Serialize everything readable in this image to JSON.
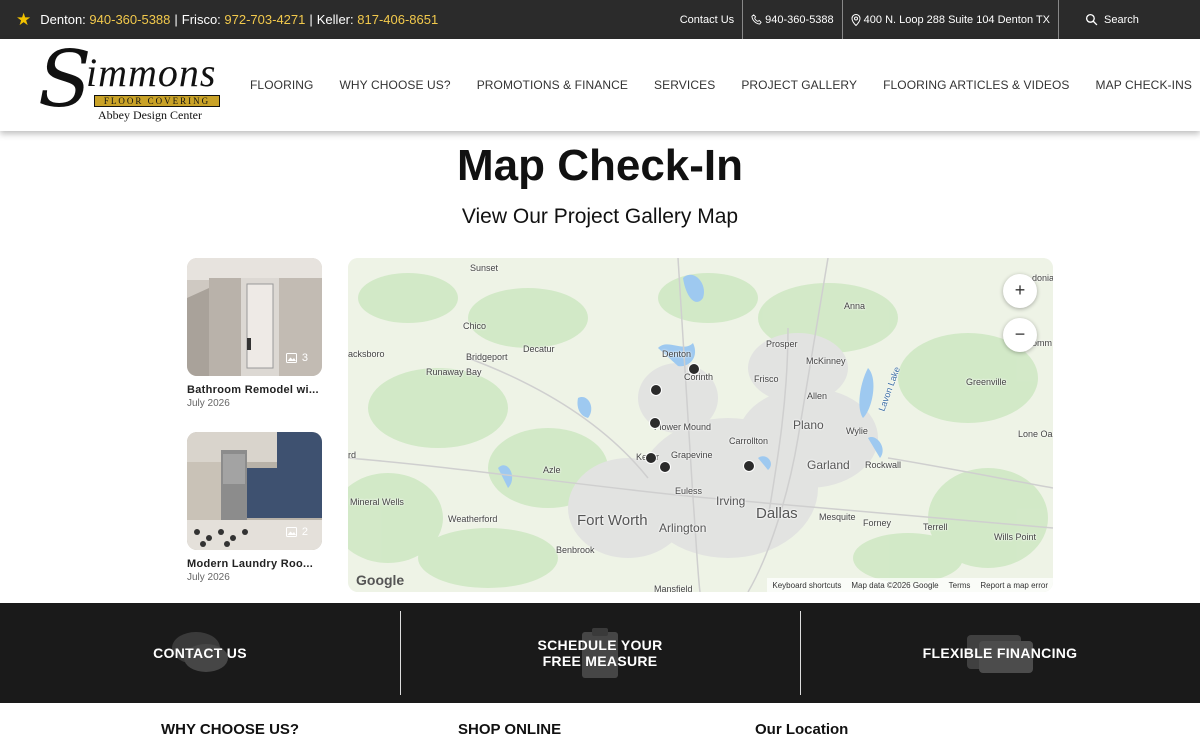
{
  "topbar": {
    "phones": [
      {
        "label": "Denton:",
        "number": "940-360-5388"
      },
      {
        "label": "Frisco:",
        "number": "972-703-4271"
      },
      {
        "label": "Keller:",
        "number": "817-406-8651"
      }
    ],
    "separator": "|",
    "contact": "Contact Us",
    "phone": "940-360-5388",
    "address": "400 N. Loop 288 Suite 104 Denton TX",
    "search": "Search"
  },
  "logo": {
    "letter": "S",
    "word": "immons",
    "band": "FLOOR COVERING",
    "sub": "Abbey Design Center"
  },
  "nav": [
    "FLOORING",
    "WHY CHOOSE US?",
    "PROMOTIONS & FINANCE",
    "SERVICES",
    "PROJECT GALLERY",
    "FLOORING ARTICLES & VIDEOS",
    "MAP CHECK-INS"
  ],
  "page": {
    "title": "Map Check-In",
    "subtitle": "View Our Project Gallery Map"
  },
  "gallery": [
    {
      "title": "Bathroom Remodel wi...",
      "date": "July 2026",
      "count": "3"
    },
    {
      "title": "Modern Laundry Roo...",
      "date": "July 2026",
      "count": "2"
    }
  ],
  "map": {
    "cities": [
      "Sunset",
      "Anna",
      "Chico",
      "Decatur",
      "Bridgeport",
      "Denton",
      "Prosper",
      "McKinney",
      "acksboro",
      "Runaway Bay",
      "Corinth",
      "Frisco",
      "Allen",
      "Greenville",
      "Lavon Lake",
      "Flower Mound",
      "Plano",
      "Wylie",
      "Lone Oa",
      "Carrollton",
      "Keller",
      "Grapevine",
      "Garland",
      "Rockwall",
      "Azle",
      "Euless",
      "Irving",
      "Mineral Wells",
      "Weatherford",
      "Fort Worth",
      "Arlington",
      "Dallas",
      "Mesquite",
      "Forney",
      "Terrell",
      "Wills Point",
      "Benbrook",
      "Mansfield",
      "rd",
      "donia",
      "omm"
    ],
    "zoom_in": "+",
    "zoom_out": "−",
    "google": "Google",
    "attribution": [
      "Keyboard shortcuts",
      "Map data ©2026 Google",
      "Terms",
      "Report a map error"
    ]
  },
  "cta": {
    "contact": "CONTACT US",
    "schedule_1": "SCHEDULE YOUR",
    "schedule_2": "FREE MEASURE",
    "financing": "FLEXIBLE FINANCING"
  },
  "footer": {
    "why": "WHY CHOOSE US?",
    "shop": "SHOP ONLINE",
    "location": "Our Location"
  },
  "colors": {
    "topbar_bg": "#2b2b2b",
    "accent_yellow": "#f2c94c",
    "cta_bg": "#1a1a1a",
    "map_land": "#eef3e6",
    "map_water": "#9ec9f0"
  }
}
